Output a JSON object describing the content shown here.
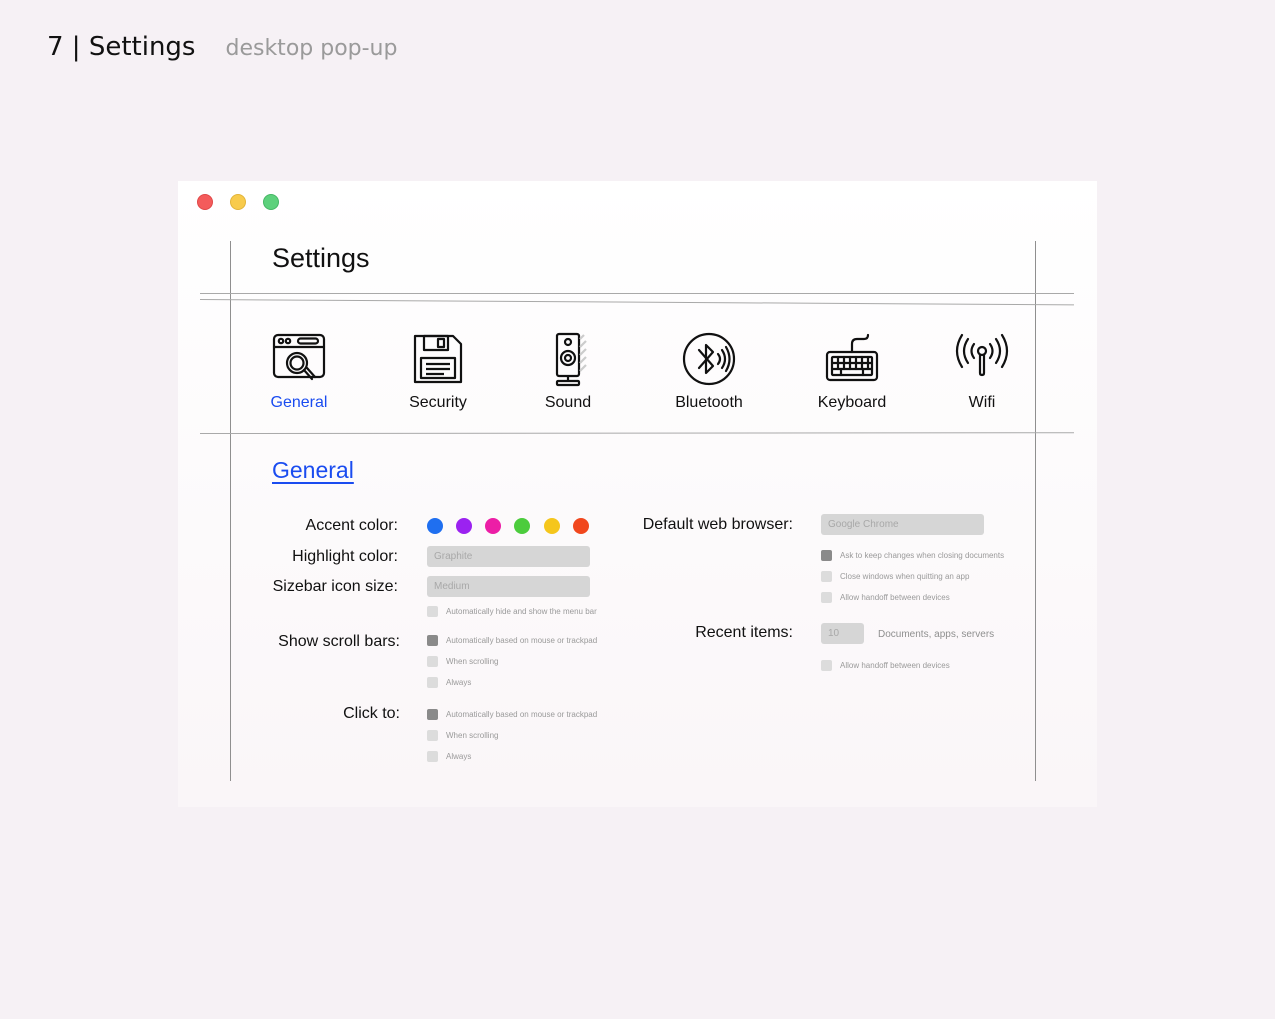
{
  "page": {
    "number_title": "7 | Settings",
    "subtitle": "desktop pop-up"
  },
  "window": {
    "title": "Settings",
    "tabs": [
      {
        "label": "General",
        "icon": "browser-search-icon",
        "active": true
      },
      {
        "label": "Security",
        "icon": "floppy-disk-icon",
        "active": false
      },
      {
        "label": "Sound",
        "icon": "speaker-icon",
        "active": false
      },
      {
        "label": "Bluetooth",
        "icon": "bluetooth-icon",
        "active": false
      },
      {
        "label": "Keyboard",
        "icon": "keyboard-icon",
        "active": false
      },
      {
        "label": "Wifi",
        "icon": "wifi-antenna-icon",
        "active": false
      }
    ],
    "section_title": "General"
  },
  "general": {
    "accent_label": "Accent color:",
    "accent_colors": [
      "#1f6ff0",
      "#9b22f0",
      "#ec1ea6",
      "#4ccc3d",
      "#f5c61c",
      "#f1471d"
    ],
    "highlight_label": "Highlight color:",
    "highlight_value": "Graphite",
    "sidebar_label": "Sizebar icon size:",
    "sidebar_value": "Medium",
    "menu_bar_option": {
      "text": "Automatically hide and show the menu bar",
      "checked": false
    },
    "scroll_label": "Show scroll bars:",
    "scroll_options": [
      {
        "text": "Automatically based on mouse or trackpad",
        "checked": true
      },
      {
        "text": "When scrolling",
        "checked": false
      },
      {
        "text": "Always",
        "checked": false
      }
    ],
    "click_label": "Click to:",
    "click_options": [
      {
        "text": "Automatically based on mouse or trackpad",
        "checked": true
      },
      {
        "text": "When scrolling",
        "checked": false
      },
      {
        "text": "Always",
        "checked": false
      }
    ],
    "browser_label": "Default web browser:",
    "browser_value": "Google Chrome",
    "document_options": [
      {
        "text": "Ask to keep changes when closing documents",
        "checked": true
      },
      {
        "text": "Close windows when quitting an app",
        "checked": false
      },
      {
        "text": "Allow handoff between devices",
        "checked": false
      }
    ],
    "recent_label": "Recent items:",
    "recent_value": "10",
    "recent_note": "Documents, apps, servers",
    "handoff_option": {
      "text": "Allow handoff between devices",
      "checked": false
    }
  }
}
